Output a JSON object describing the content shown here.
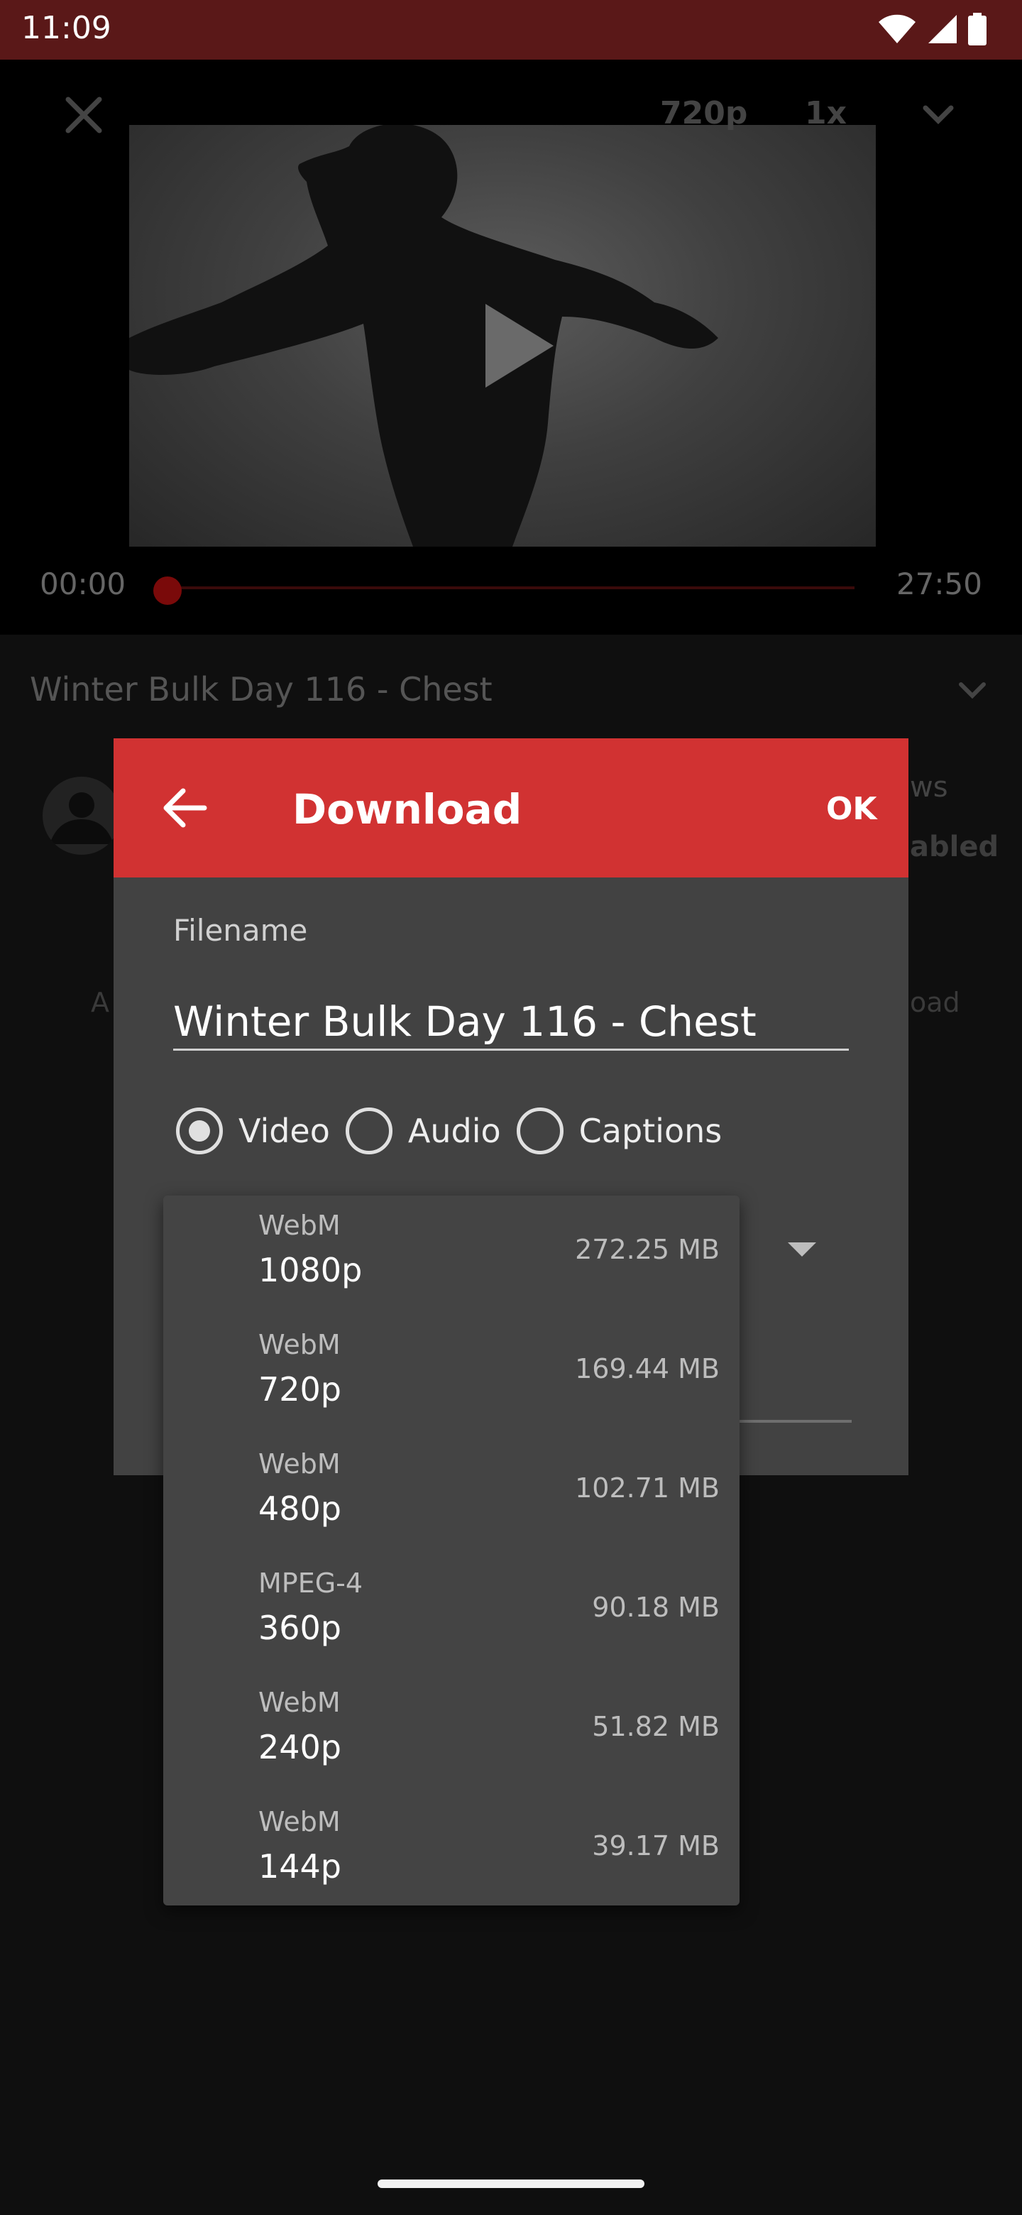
{
  "status_bar": {
    "time": "11:09"
  },
  "player": {
    "quality": "720p",
    "speed": "1x",
    "time_current": "00:00",
    "time_total": "27:50",
    "progress": 0
  },
  "video_info": {
    "title": "Winter Bulk Day 116 - Chest",
    "views_fragment": "ws",
    "enabled_fragment": "abled",
    "left_fragment": "A",
    "download_fragment": "oad"
  },
  "dialog": {
    "title": "Download",
    "ok_label": "OK",
    "filename_label": "Filename",
    "filename_value": "Winter Bulk Day 116 - Chest",
    "type_options": [
      {
        "label": "Video",
        "selected": true
      },
      {
        "label": "Audio",
        "selected": false
      },
      {
        "label": "Captions",
        "selected": false
      }
    ]
  },
  "quality_dropdown": {
    "items": [
      {
        "format": "WebM",
        "resolution": "1080p",
        "size": "272.25 MB"
      },
      {
        "format": "WebM",
        "resolution": "720p",
        "size": "169.44 MB"
      },
      {
        "format": "WebM",
        "resolution": "480p",
        "size": "102.71 MB"
      },
      {
        "format": "MPEG-4",
        "resolution": "360p",
        "size": "90.18 MB"
      },
      {
        "format": "WebM",
        "resolution": "240p",
        "size": "51.82 MB"
      },
      {
        "format": "WebM",
        "resolution": "144p",
        "size": "39.17 MB"
      }
    ]
  },
  "colors": {
    "status_bar": "#5a1818",
    "dialog_header": "#d13232",
    "dialog_body": "#424242",
    "dropdown_bg": "#444444"
  }
}
